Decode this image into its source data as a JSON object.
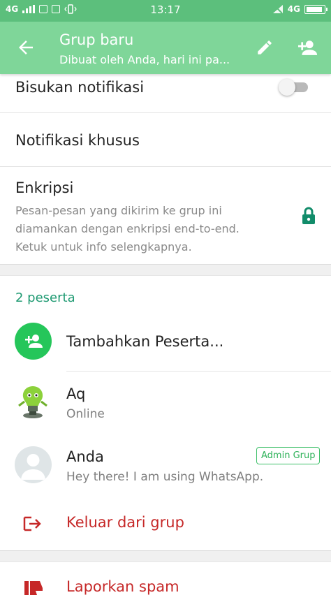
{
  "status_bar": {
    "network_left": "4G",
    "time": "13:17",
    "network_right": "4G",
    "battery_level": 0.9
  },
  "app_bar": {
    "title": "Grup baru",
    "subtitle": "Dibuat oleh Anda, hari ini pa..."
  },
  "settings": {
    "mute_label": "Bisukan notifikasi",
    "mute_enabled": false,
    "custom_notifications_label": "Notifikasi khusus",
    "encryption_title": "Enkripsi",
    "encryption_description": "Pesan-pesan yang dikirim ke grup ini diamankan dengan enkripsi end-to-end. Ketuk untuk info selengkapnya."
  },
  "participants": {
    "count_label": "2 peserta",
    "add_label": "Tambahkan Peserta...",
    "members": [
      {
        "name": "Aq",
        "status": "Online",
        "badge": ""
      },
      {
        "name": "Anda",
        "status": "Hey there! I am using WhatsApp.",
        "badge": "Admin Grup"
      }
    ]
  },
  "actions": {
    "exit_label": "Keluar dari grup",
    "report_label": "Laporkan spam"
  },
  "colors": {
    "status_bar": "#5cbf7c",
    "app_bar": "#7fd699",
    "accent": "#1f9a72",
    "add_button": "#25c65a",
    "danger": "#c62828"
  }
}
